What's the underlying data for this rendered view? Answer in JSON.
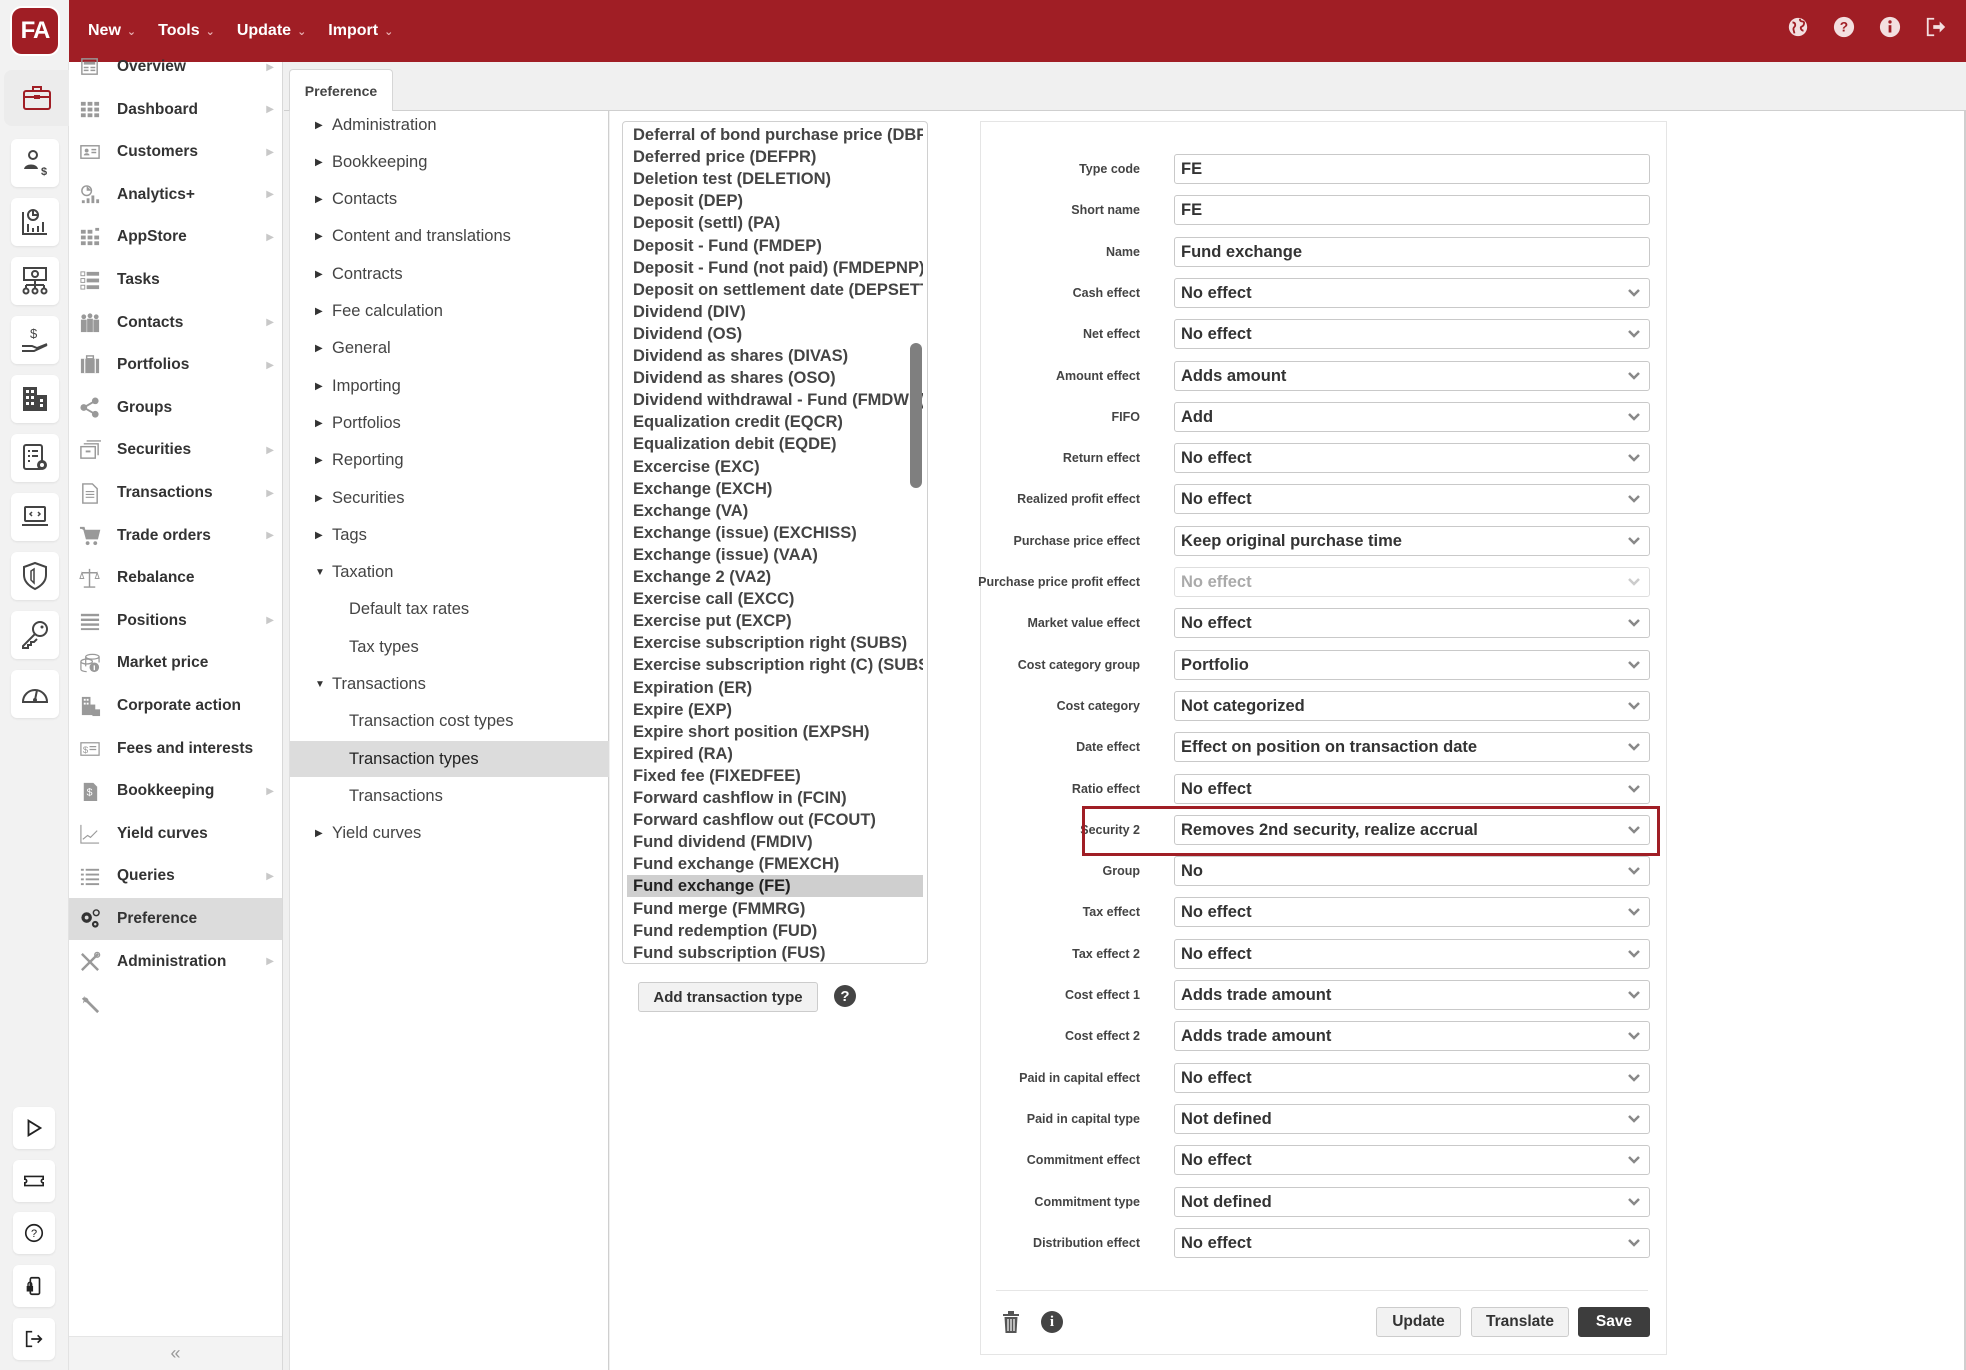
{
  "app": {
    "logo_text": "FA",
    "brand_color": "#a01e25"
  },
  "topbar": {
    "menus": [
      {
        "label": "New"
      },
      {
        "label": "Tools"
      },
      {
        "label": "Update"
      },
      {
        "label": "Import"
      }
    ],
    "icons": [
      "globe-icon",
      "help-icon",
      "info-icon",
      "logout-icon"
    ]
  },
  "rail": {
    "icons": [
      "briefcase-icon",
      "customer-dollar-icon",
      "analytics-chart-icon",
      "money-network-icon",
      "hand-dollar-icon",
      "building-icon",
      "report-settings-icon",
      "laptop-code-icon",
      "shield-icon",
      "key-icon",
      "speedometer-icon"
    ],
    "bottom_icons": [
      "play-icon",
      "ticket-icon",
      "question-icon",
      "phone-lock-icon",
      "exit-icon"
    ]
  },
  "nav": {
    "items": [
      {
        "label": "Overview",
        "icon": "overview-icon",
        "arrow": true
      },
      {
        "label": "Dashboard",
        "icon": "dashboard-icon",
        "arrow": true
      },
      {
        "label": "Customers",
        "icon": "customers-icon",
        "arrow": true
      },
      {
        "label": "Analytics+",
        "icon": "analytics-icon",
        "arrow": true
      },
      {
        "label": "AppStore",
        "icon": "appstore-icon",
        "arrow": true
      },
      {
        "label": "Tasks",
        "icon": "tasks-icon",
        "arrow": false
      },
      {
        "label": "Contacts",
        "icon": "contacts-icon",
        "arrow": true
      },
      {
        "label": "Portfolios",
        "icon": "portfolios-icon",
        "arrow": true
      },
      {
        "label": "Groups",
        "icon": "groups-share-icon",
        "arrow": false
      },
      {
        "label": "Securities",
        "icon": "securities-icon",
        "arrow": true
      },
      {
        "label": "Transactions",
        "icon": "transactions-doc-icon",
        "arrow": true
      },
      {
        "label": "Trade orders",
        "icon": "cart-icon",
        "arrow": true
      },
      {
        "label": "Rebalance",
        "icon": "scale-icon",
        "arrow": false
      },
      {
        "label": "Positions",
        "icon": "positions-icon",
        "arrow": true
      },
      {
        "label": "Market price",
        "icon": "coins-icon",
        "arrow": false
      },
      {
        "label": "Corporate action",
        "icon": "corporate-icon",
        "arrow": false
      },
      {
        "label": "Fees and interests",
        "icon": "fees-icon",
        "arrow": false
      },
      {
        "label": "Bookkeeping",
        "icon": "bookkeeping-icon",
        "arrow": true
      },
      {
        "label": "Yield curves",
        "icon": "yield-curve-icon",
        "arrow": false
      },
      {
        "label": "Queries",
        "icon": "queries-icon",
        "arrow": true
      },
      {
        "label": "Preference",
        "icon": "gears-icon",
        "arrow": false,
        "active": true
      },
      {
        "label": "Administration",
        "icon": "tools-icon",
        "arrow": true
      },
      {
        "label": "",
        "icon": "wrench-icon",
        "arrow": false
      }
    ],
    "collapse_label": "«"
  },
  "tabs": [
    {
      "label": "Preference",
      "active": true
    }
  ],
  "tree": {
    "items": [
      {
        "label": "Administration",
        "level": 0,
        "expanded": false
      },
      {
        "label": "Bookkeeping",
        "level": 0,
        "expanded": false
      },
      {
        "label": "Contacts",
        "level": 0,
        "expanded": false
      },
      {
        "label": "Content and translations",
        "level": 0,
        "expanded": false
      },
      {
        "label": "Contracts",
        "level": 0,
        "expanded": false
      },
      {
        "label": "Fee calculation",
        "level": 0,
        "expanded": false
      },
      {
        "label": "General",
        "level": 0,
        "expanded": false
      },
      {
        "label": "Importing",
        "level": 0,
        "expanded": false
      },
      {
        "label": "Portfolios",
        "level": 0,
        "expanded": false
      },
      {
        "label": "Reporting",
        "level": 0,
        "expanded": false
      },
      {
        "label": "Securities",
        "level": 0,
        "expanded": false
      },
      {
        "label": "Tags",
        "level": 0,
        "expanded": false
      },
      {
        "label": "Taxation",
        "level": 0,
        "expanded": true
      },
      {
        "label": "Default tax rates",
        "level": 1
      },
      {
        "label": "Tax types",
        "level": 1
      },
      {
        "label": "Transactions",
        "level": 0,
        "expanded": true
      },
      {
        "label": "Transaction cost types",
        "level": 1
      },
      {
        "label": "Transaction types",
        "level": 1,
        "active": true
      },
      {
        "label": "Transactions",
        "level": 1
      },
      {
        "label": "Yield curves",
        "level": 0,
        "expanded": false
      }
    ]
  },
  "transaction_types": {
    "items": [
      "Deferral of bond purchase price (DBPP",
      "Deferred price (DEFPR)",
      "Deletion test (DELETION)",
      "Deposit (DEP)",
      "Deposit (settl) (PA)",
      "Deposit - Fund (FMDEP)",
      "Deposit - Fund (not paid) (FMDEPNP)",
      "Deposit on settlement date (DEPSETTL",
      "Dividend (DIV)",
      "Dividend (OS)",
      "Dividend as shares (DIVAS)",
      "Dividend as shares (OSO)",
      "Dividend withdrawal - Fund (FMDWD)",
      "Equalization credit (EQCR)",
      "Equalization debit (EQDE)",
      "Excercise (EXC)",
      "Exchange (EXCH)",
      "Exchange (VA)",
      "Exchange (issue) (EXCHISS)",
      "Exchange (issue) (VAA)",
      "Exchange 2 (VA2)",
      "Exercise call (EXCC)",
      "Exercise put (EXCP)",
      "Exercise subscription right (SUBS)",
      "Exercise subscription right (C) (SUBSC)",
      "Expiration (ER)",
      "Expire (EXP)",
      "Expire short position (EXPSH)",
      "Expired (RA)",
      "Fixed fee (FIXEDFEE)",
      "Forward cashflow in (FCIN)",
      "Forward cashflow out (FCOUT)",
      "Fund dividend (FMDIV)",
      "Fund exchange (FMEXCH)",
      "Fund exchange (FE)",
      "Fund merge (FMMRG)",
      "Fund redemption (FUD)",
      "Fund subscription (FUS)"
    ],
    "selected_index": 34,
    "add_button_label": "Add transaction type",
    "help_label": "?"
  },
  "form": {
    "fields": [
      {
        "label": "Type code",
        "value": "FE",
        "type": "input"
      },
      {
        "label": "Short name",
        "value": "FE",
        "type": "input"
      },
      {
        "label": "Name",
        "value": "Fund exchange",
        "type": "input"
      },
      {
        "label": "Cash effect",
        "value": "No effect",
        "type": "select"
      },
      {
        "label": "Net effect",
        "value": "No effect",
        "type": "select"
      },
      {
        "label": "Amount effect",
        "value": "Adds amount",
        "type": "select"
      },
      {
        "label": "FIFO",
        "value": "Add",
        "type": "select"
      },
      {
        "label": "Return effect",
        "value": "No effect",
        "type": "select"
      },
      {
        "label": "Realized profit effect",
        "value": "No effect",
        "type": "select"
      },
      {
        "label": "Purchase price effect",
        "value": "Keep original purchase time",
        "type": "select"
      },
      {
        "label": "Purchase price profit effect",
        "value": "No effect",
        "type": "select",
        "disabled": true
      },
      {
        "label": "Market value effect",
        "value": "No effect",
        "type": "select"
      },
      {
        "label": "Cost category group",
        "value": "Portfolio",
        "type": "select"
      },
      {
        "label": "Cost category",
        "value": "Not categorized",
        "type": "select"
      },
      {
        "label": "Date effect",
        "value": "Effect on position on transaction date",
        "type": "select"
      },
      {
        "label": "Ratio effect",
        "value": "No effect",
        "type": "select"
      },
      {
        "label": "Security 2",
        "value": "Removes 2nd security, realize accrual",
        "type": "select",
        "highlighted": true
      },
      {
        "label": "Group",
        "value": "No",
        "type": "select"
      },
      {
        "label": "Tax effect",
        "value": "No effect",
        "type": "select"
      },
      {
        "label": "Tax effect 2",
        "value": "No effect",
        "type": "select"
      },
      {
        "label": "Cost effect 1",
        "value": "Adds trade amount",
        "type": "select"
      },
      {
        "label": "Cost effect 2",
        "value": "Adds trade amount",
        "type": "select"
      },
      {
        "label": "Paid in capital effect",
        "value": "No effect",
        "type": "select"
      },
      {
        "label": "Paid in capital type",
        "value": "Not defined",
        "type": "select"
      },
      {
        "label": "Commitment effect",
        "value": "No effect",
        "type": "select"
      },
      {
        "label": "Commitment type",
        "value": "Not defined",
        "type": "select"
      },
      {
        "label": "Distribution effect",
        "value": "No effect",
        "type": "select"
      }
    ],
    "buttons": {
      "update": "Update",
      "translate": "Translate",
      "save": "Save"
    },
    "info_label": "i",
    "highlight_color": "#a01e25"
  }
}
